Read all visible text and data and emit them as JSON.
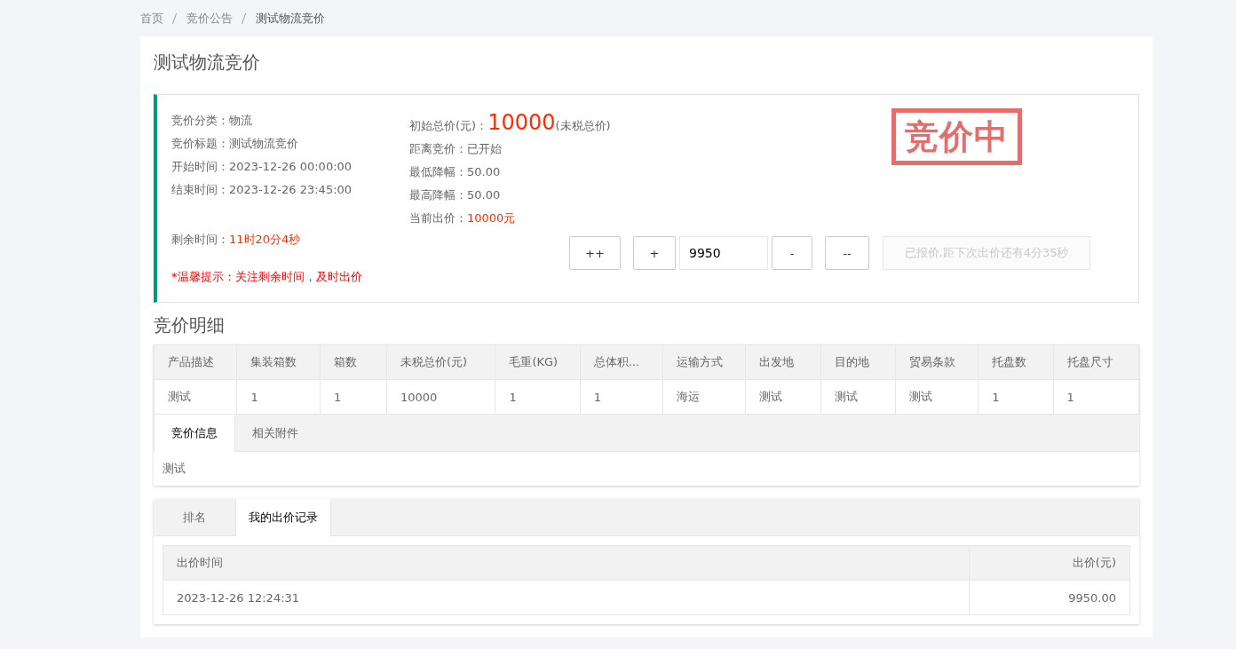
{
  "breadcrumb": [
    {
      "label": "首页",
      "current": false
    },
    {
      "label": "竞价公告",
      "current": false
    },
    {
      "label": "测试物流竞价",
      "current": true
    }
  ],
  "title": "测试物流竞价",
  "info": {
    "left": [
      {
        "label": "竞价分类：",
        "value": "物流",
        "highlight": false
      },
      {
        "label": "竞价标题：",
        "value": "测试物流竞价",
        "highlight": false
      },
      {
        "label": "开始时间：",
        "value": "2023-12-26 00:00:00",
        "highlight": false
      },
      {
        "label": "结束时间：",
        "value": "2023-12-26 23:45:00",
        "highlight": false
      }
    ],
    "remaining": {
      "label": "剩余时间：",
      "value": "11时20分4秒",
      "highlight": true
    },
    "tip": "*温馨提示：关注剩余时间，及时出价",
    "initial_price": {
      "label": "初始总价(元)：",
      "value": "10000",
      "note": "(未税总价)"
    },
    "right": [
      {
        "label": "距离竞价：",
        "value": "已开始",
        "highlight": false
      },
      {
        "label": "最低降幅：",
        "value": "50.00",
        "highlight": false
      },
      {
        "label": "最高降幅：",
        "value": "50.00",
        "highlight": false
      },
      {
        "label": "当前出价：",
        "value": "10000元",
        "highlight": true
      }
    ],
    "stamp": "竞价中",
    "bid_controls": {
      "big_up": "++",
      "up": "+",
      "value": "9950",
      "down": "-",
      "big_down": "--",
      "submit": "已报价,距下次出价还有4分35秒",
      "submit_disabled": true
    }
  },
  "detail_title": "竞价明细",
  "detail_table": {
    "columns": [
      "产品描述",
      "集装箱数",
      "箱数",
      "未税总价(元)",
      "毛重(KG)",
      "总体积...",
      "运输方式",
      "出发地",
      "目的地",
      "贸易条款",
      "托盘数",
      "托盘尺寸"
    ],
    "rows": [
      [
        "测试",
        "1",
        "1",
        "10000",
        "1",
        "1",
        "海运",
        "测试",
        "测试",
        "测试",
        "1",
        "1"
      ]
    ]
  },
  "info_tabs": {
    "tabs": [
      {
        "label": "竞价信息",
        "selected": true
      },
      {
        "label": "相关附件",
        "selected": false
      }
    ],
    "content": "测试"
  },
  "record_tabs": {
    "tabs": [
      {
        "label": "排名",
        "selected": false
      },
      {
        "label": "我的出价记录",
        "selected": true
      }
    ],
    "columns": [
      "出价时间",
      "出价(元)"
    ],
    "rows": [
      [
        "2023-12-26 12:24:31",
        "9950.00"
      ]
    ]
  }
}
